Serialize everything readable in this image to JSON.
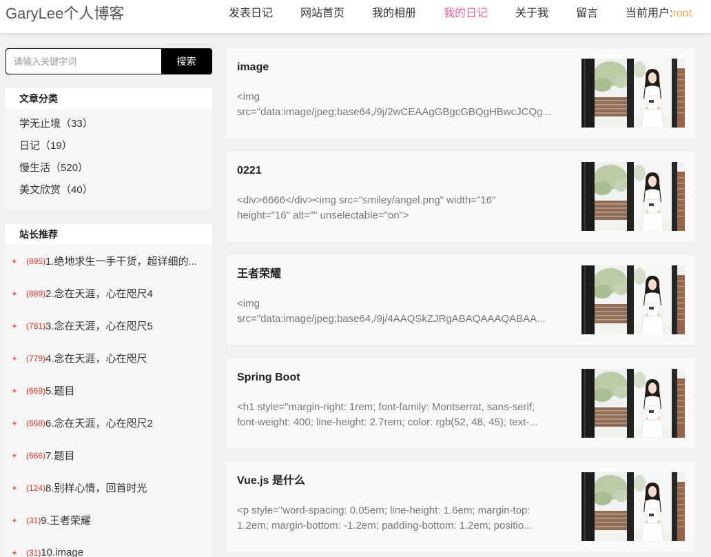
{
  "header": {
    "logo": "GaryLee个人博客",
    "nav": [
      {
        "label": "发表日记",
        "active": false
      },
      {
        "label": "网站首页",
        "active": false
      },
      {
        "label": "我的相册",
        "active": false
      },
      {
        "label": "我的日记",
        "active": true
      },
      {
        "label": "关于我",
        "active": false
      },
      {
        "label": "留言",
        "active": false
      }
    ],
    "current_user_label": "当前用户:",
    "current_user": "root"
  },
  "search": {
    "placeholder": "请输入关键字词",
    "button_label": "搜索"
  },
  "categories": {
    "title": "文章分类",
    "items": [
      {
        "name": "学无止境",
        "count": "（33）"
      },
      {
        "name": "日记",
        "count": "（19）"
      },
      {
        "name": "慢生活",
        "count": "（520）"
      },
      {
        "name": "美文欣赏",
        "count": "（40）"
      }
    ]
  },
  "recommend": {
    "title": "站长推荐",
    "bullet_icon": "sparkle-icon",
    "items": [
      {
        "views": "(895)",
        "title": "1.绝地求生一手干货，超详细的..."
      },
      {
        "views": "(889)",
        "title": "2.念在天涯，心在咫尺4"
      },
      {
        "views": "(781)",
        "title": "3.念在天涯，心在咫尺5"
      },
      {
        "views": "(779)",
        "title": "4.念在天涯，心在咫尺"
      },
      {
        "views": "(669)",
        "title": "5.题目"
      },
      {
        "views": "(668)",
        "title": "6.念在天涯，心在咫尺2"
      },
      {
        "views": "(666)",
        "title": "7.题目"
      },
      {
        "views": "(124)",
        "title": "8.别样心情，回首时光"
      },
      {
        "views": "(31)",
        "title": "9.王者荣耀"
      },
      {
        "views": "(31)",
        "title": "10.image"
      }
    ]
  },
  "posts": [
    {
      "title": "image",
      "desc_lines": [
        "<img",
        "src=\"data:image/jpeg;base64,/9j/2wCEAAgGBgcGBQgHBwcJCQg..."
      ]
    },
    {
      "title": "0221",
      "desc_lines": [
        "<div>6666</div><img src=\"smiley/angel.png\" width=\"16\"",
        "height=\"16\" alt=\"\" unselectable=\"on\">"
      ]
    },
    {
      "title": "王者荣耀",
      "desc_lines": [
        "<img",
        "src=\"data:image/jpeg;base64,/9j/4AAQSkZJRgABAQAAAQABAA..."
      ]
    },
    {
      "title": "Spring Boot",
      "desc_lines": [
        "<h1 style=\"margin-right: 1rem; font-family: Montserrat, sans-serif;",
        "font-weight: 400; line-height: 2.7rem; color: rgb(52, 48, 45); text-..."
      ]
    },
    {
      "title": "Vue.js 是什么",
      "desc_lines": [
        "<p style=\"word-spacing: 0.05em; line-height: 1.6em; margin-top:",
        "1.2em; margin-bottom: -1.2em; padding-bottom: 1.2em; positio..."
      ]
    }
  ],
  "colors": {
    "active_nav": "#e55d9b",
    "current_user": "#f0a457",
    "view_count": "#d9342b",
    "bullet": "#e0483e",
    "header_bg": "#ffffff",
    "page_bg": "#f0f0f0",
    "search_button": "#000000"
  }
}
